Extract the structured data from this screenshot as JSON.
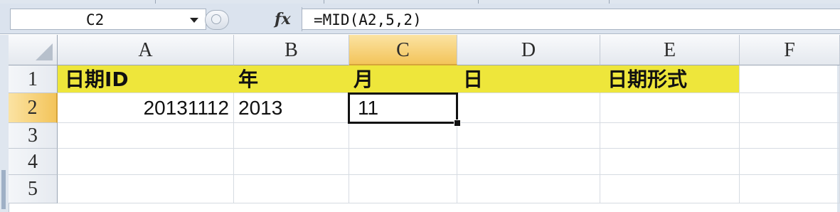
{
  "formula_bar": {
    "name_box": "C2",
    "fx_label": "fx",
    "formula": "=MID(A2,5,2)"
  },
  "columns": [
    "A",
    "B",
    "C",
    "D",
    "E",
    "F"
  ],
  "rows": [
    "1",
    "2",
    "3",
    "4",
    "5"
  ],
  "cells": {
    "A1": "日期ID",
    "B1": "年",
    "C1": "月",
    "D1": "日",
    "E1": "日期形式",
    "A2": "20131112",
    "B2": "2013",
    "C2": "11"
  },
  "active_cell": "C2",
  "colors": {
    "header_fill": "#eee63b",
    "active_header": "#f3c45a"
  }
}
